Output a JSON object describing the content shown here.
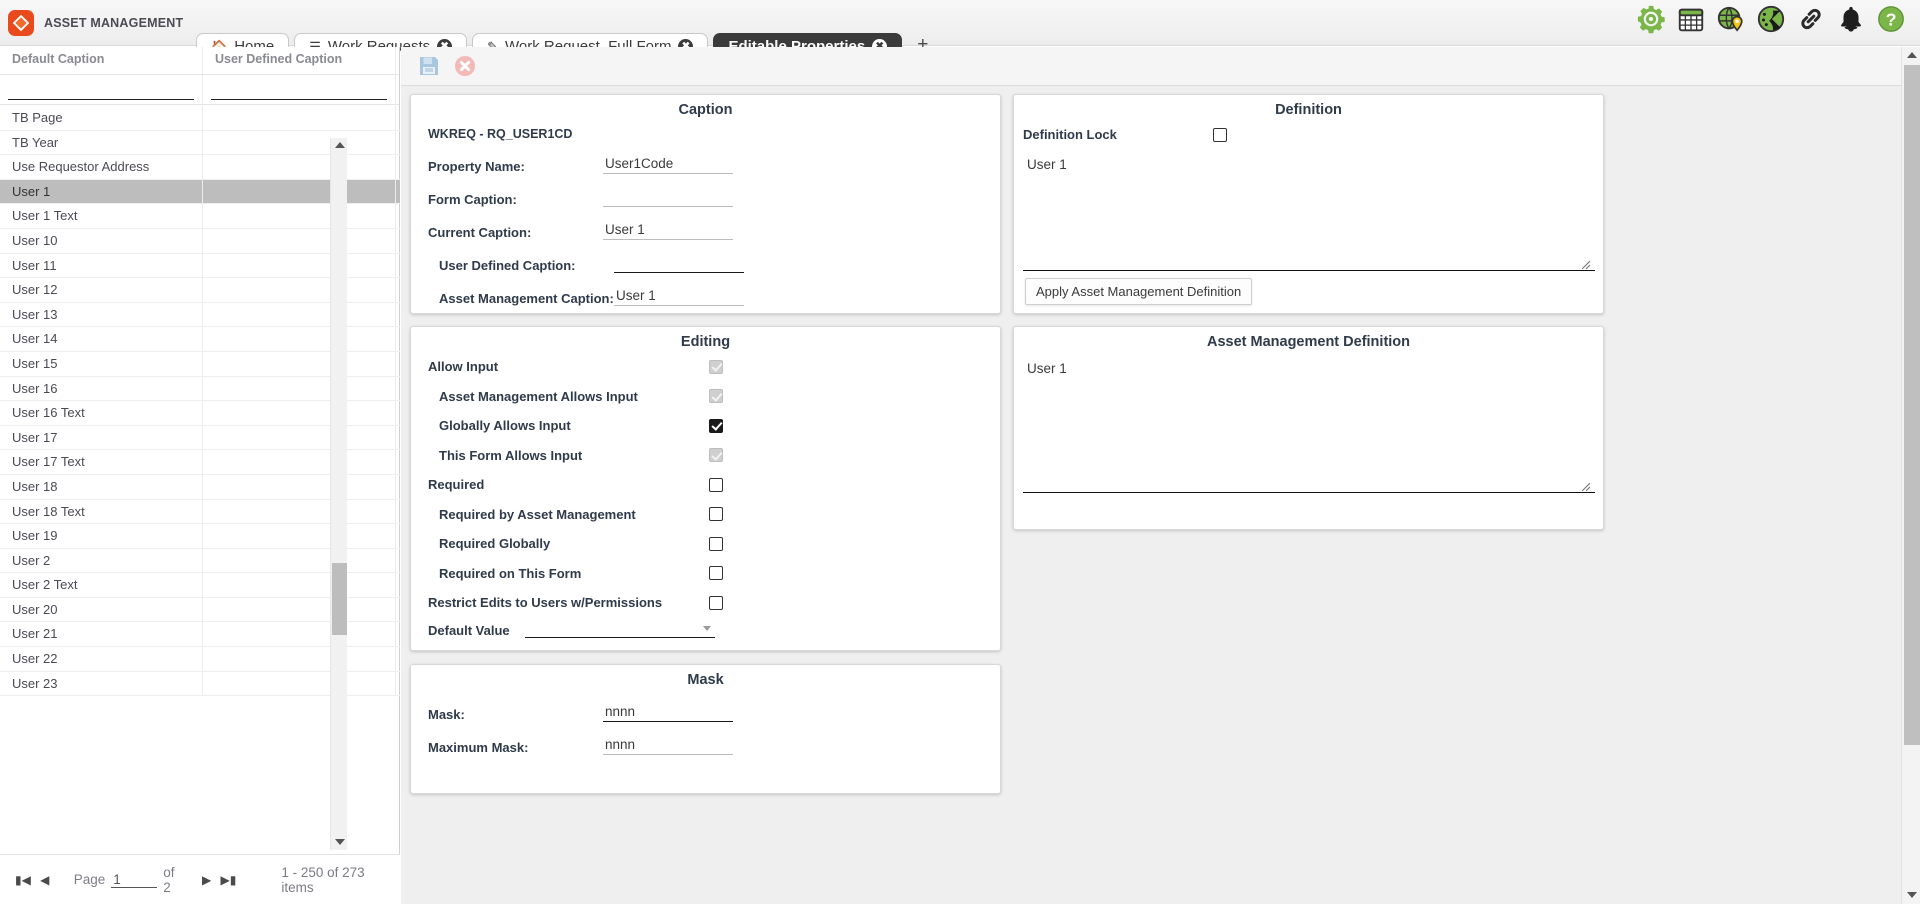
{
  "app": {
    "brand": "ASSET MANAGEMENT",
    "logo_icon": "diamond-logo-icon",
    "accent_green": "#7ab648",
    "accent_orange": "#e8491d"
  },
  "topbar": {
    "icons": [
      {
        "name": "gear-icon",
        "title": "Settings"
      },
      {
        "name": "calendar-icon",
        "title": "Calendar"
      },
      {
        "name": "globe-pin-icon",
        "title": "Map"
      },
      {
        "name": "dashboard-icon",
        "title": "Dashboard"
      },
      {
        "name": "link-icon",
        "title": "Links"
      },
      {
        "name": "bell-icon",
        "title": "Notifications"
      },
      {
        "name": "help-icon",
        "title": "Help"
      }
    ]
  },
  "tabs": {
    "items": [
      {
        "label": "Home",
        "glyph": "home-icon",
        "closable": false,
        "active": false
      },
      {
        "label": "Work Requests",
        "glyph": "list-icon",
        "closable": true,
        "active": false
      },
      {
        "label": "Work Request_Full Form",
        "glyph": "pencil-icon",
        "closable": true,
        "active": false
      },
      {
        "label": "Editable Properties",
        "glyph": "",
        "closable": true,
        "active": true
      }
    ],
    "add_label": "+"
  },
  "grid": {
    "columns": [
      "Default Caption",
      "User Defined Caption"
    ],
    "filters": {
      "default_caption": "",
      "user_defined_caption": ""
    },
    "rows": [
      {
        "default_caption": "TB Page",
        "user_defined_caption": "",
        "selected": false
      },
      {
        "default_caption": "TB Year",
        "user_defined_caption": "",
        "selected": false
      },
      {
        "default_caption": "Use Requestor Address",
        "user_defined_caption": "",
        "selected": false
      },
      {
        "default_caption": "User 1",
        "user_defined_caption": "",
        "selected": true
      },
      {
        "default_caption": "User 1 Text",
        "user_defined_caption": "",
        "selected": false
      },
      {
        "default_caption": "User 10",
        "user_defined_caption": "",
        "selected": false
      },
      {
        "default_caption": "User 11",
        "user_defined_caption": "",
        "selected": false
      },
      {
        "default_caption": "User 12",
        "user_defined_caption": "",
        "selected": false
      },
      {
        "default_caption": "User 13",
        "user_defined_caption": "",
        "selected": false
      },
      {
        "default_caption": "User 14",
        "user_defined_caption": "",
        "selected": false
      },
      {
        "default_caption": "User 15",
        "user_defined_caption": "",
        "selected": false
      },
      {
        "default_caption": "User 16",
        "user_defined_caption": "",
        "selected": false
      },
      {
        "default_caption": "User 16 Text",
        "user_defined_caption": "",
        "selected": false
      },
      {
        "default_caption": "User 17",
        "user_defined_caption": "",
        "selected": false
      },
      {
        "default_caption": "User 17 Text",
        "user_defined_caption": "",
        "selected": false
      },
      {
        "default_caption": "User 18",
        "user_defined_caption": "",
        "selected": false
      },
      {
        "default_caption": "User 18 Text",
        "user_defined_caption": "",
        "selected": false
      },
      {
        "default_caption": "User 19",
        "user_defined_caption": "",
        "selected": false
      },
      {
        "default_caption": "User 2",
        "user_defined_caption": "",
        "selected": false
      },
      {
        "default_caption": "User 2 Text",
        "user_defined_caption": "",
        "selected": false
      },
      {
        "default_caption": "User 20",
        "user_defined_caption": "",
        "selected": false
      },
      {
        "default_caption": "User 21",
        "user_defined_caption": "",
        "selected": false
      },
      {
        "default_caption": "User 22",
        "user_defined_caption": "",
        "selected": false
      },
      {
        "default_caption": "User 23",
        "user_defined_caption": "",
        "selected": false
      }
    ],
    "pager": {
      "first_icon": "first-page-icon",
      "prev_icon": "previous-page-icon",
      "next_icon": "next-page-icon",
      "last_icon": "last-page-icon",
      "page_label": "Page",
      "page_value": "1",
      "of_label": "of 2",
      "items_label": "1 - 250 of 273 items"
    }
  },
  "toolbar": {
    "save_icon": "save-icon",
    "cancel_icon": "cancel-icon"
  },
  "caption_card": {
    "title": "Caption",
    "record_id": "WKREQ - RQ_USER1CD",
    "fields": [
      {
        "label": "Property Name:",
        "value": "User1Code"
      },
      {
        "label": "Form Caption:",
        "value": ""
      },
      {
        "label": "Current Caption:",
        "value": "User 1"
      },
      {
        "label": "User Defined Caption:",
        "value": ""
      },
      {
        "label": "Asset Management Caption:",
        "value": "User 1"
      }
    ]
  },
  "editing_card": {
    "title": "Editing",
    "rows": [
      {
        "label": "Allow Input",
        "state": "checked-disabled",
        "indent": 0
      },
      {
        "label": "Asset Management Allows Input",
        "state": "checked-disabled",
        "indent": 1
      },
      {
        "label": "Globally Allows Input",
        "state": "checked",
        "indent": 1
      },
      {
        "label": "This Form Allows Input",
        "state": "checked-disabled",
        "indent": 1
      },
      {
        "label": "Required",
        "state": "unchecked",
        "indent": 0
      },
      {
        "label": "Required by Asset Management",
        "state": "unchecked",
        "indent": 1
      },
      {
        "label": "Required Globally",
        "state": "unchecked",
        "indent": 1
      },
      {
        "label": "Required on This Form",
        "state": "unchecked",
        "indent": 1
      },
      {
        "label": "Restrict Edits to Users w/Permissions",
        "state": "unchecked",
        "indent": 0
      }
    ],
    "default_value": {
      "label": "Default Value",
      "value": ""
    }
  },
  "mask_card": {
    "title": "Mask",
    "fields": [
      {
        "label": "Mask:",
        "value": "nnnn"
      },
      {
        "label": "Maximum Mask:",
        "value": "nnnn"
      }
    ]
  },
  "definition_card": {
    "title": "Definition",
    "lock_label": "Definition Lock",
    "lock_state": "unchecked",
    "definition_text": "User 1",
    "apply_button": "Apply Asset Management Definition"
  },
  "am_definition_card": {
    "title": "Asset Management Definition",
    "definition_text": "User 1"
  }
}
